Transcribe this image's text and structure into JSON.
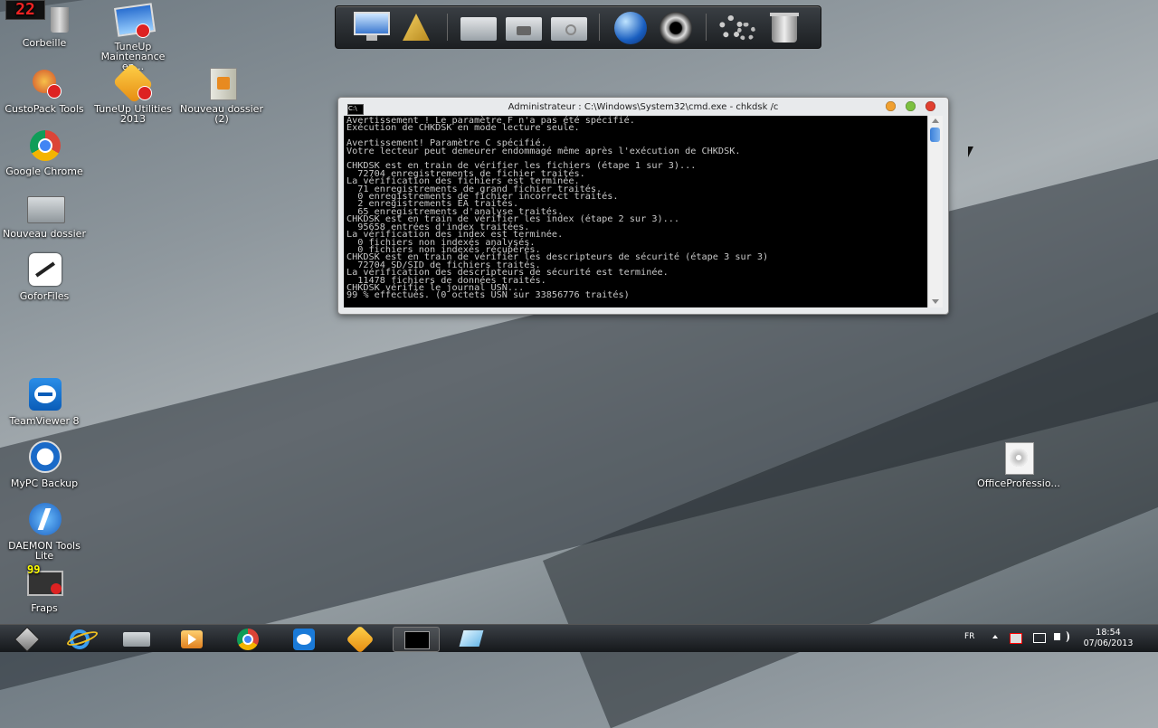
{
  "desktop": {
    "icons": [
      {
        "label": "Corbeille",
        "icon": "recycle-bin-icon"
      },
      {
        "label": "TuneUp Maintenance en...",
        "icon": "tuneup-maintenance-icon"
      },
      {
        "label": "CustoPack Tools",
        "icon": "custopack-icon"
      },
      {
        "label": "TuneUp Utilities 2013",
        "icon": "tuneup-utilities-icon"
      },
      {
        "label": "Nouveau dossier (2)",
        "icon": "folder-icon"
      },
      {
        "label": "Google Chrome",
        "icon": "chrome-icon"
      },
      {
        "label": "Nouveau dossier",
        "icon": "folder-icon"
      },
      {
        "label": "GoforFiles",
        "icon": "goforfiles-icon"
      },
      {
        "label": "TeamViewer 8",
        "icon": "teamviewer-icon"
      },
      {
        "label": "MyPC Backup",
        "icon": "mypc-backup-icon"
      },
      {
        "label": "DAEMON Tools Lite",
        "icon": "daemon-tools-icon"
      },
      {
        "label": "Fraps",
        "icon": "fraps-icon"
      },
      {
        "label": "OfficeProfessio...",
        "icon": "disc-image-icon"
      }
    ],
    "corner_counter": "22",
    "fraps_counter": "99"
  },
  "dock": {
    "items": [
      "computer-icon",
      "control-panel-icon",
      "folder-icon",
      "pictures-folder-icon",
      "music-folder-icon",
      "browser-globe-icon",
      "media-player-icon",
      "settings-gears-icon",
      "trash-icon"
    ]
  },
  "cmd_window": {
    "title": "Administrateur : C:\\Windows\\System32\\cmd.exe - chkdsk  /c",
    "lines": [
      "Avertissement ! Le paramètre F n'a pas été spécifié.",
      "Exécution de CHKDSK en mode lecture seule.",
      "",
      "Avertissement! Paramètre C spécifié.",
      "Votre lecteur peut demeurer endommagé même après l'exécution de CHKDSK.",
      "",
      "CHKDSK est en train de vérifier les fichiers (étape 1 sur 3)...",
      "  72704 enregistrements de fichier traités.",
      "La vérification des fichiers est terminée.",
      "  71 enregistrements de grand fichier traités.",
      "  0 enregistrements de fichier incorrect traités.",
      "  2 enregistrements EA traités.",
      "  65 enregistrements d'analyse traités.",
      "CHKDSK est en train de vérifier les index (étape 2 sur 3)...",
      "  95658 entrées d'index traitées.",
      "La vérification des index est terminée.",
      "  0 fichiers non indexés analysés.",
      "  0 fichiers non indexés récupérés.",
      "CHKDSK est en train de vérifier les descripteurs de sécurité (étape 3 sur 3)",
      "  72704 SD/SID de fichiers traités.",
      "La vérification des descripteurs de sécurité est terminée.",
      "  11478 fichiers de données traités.",
      "CHKDSK vérifie le journal USN...",
      "99 % effectués. (0 octets USN sur 33856776 traités)"
    ],
    "colors": {
      "minimize": "#f0a030",
      "maximize": "#7cc040",
      "close": "#e04030"
    }
  },
  "taskbar": {
    "items": [
      "start-icon",
      "internet-explorer-icon",
      "file-explorer-icon",
      "media-player-icon",
      "chrome-icon",
      "teamviewer-icon",
      "tuneup-icon",
      "cmd-icon",
      "notepad-icon"
    ],
    "active_index": 7,
    "language": "FR",
    "time": "18:54",
    "date": "07/06/2013"
  }
}
